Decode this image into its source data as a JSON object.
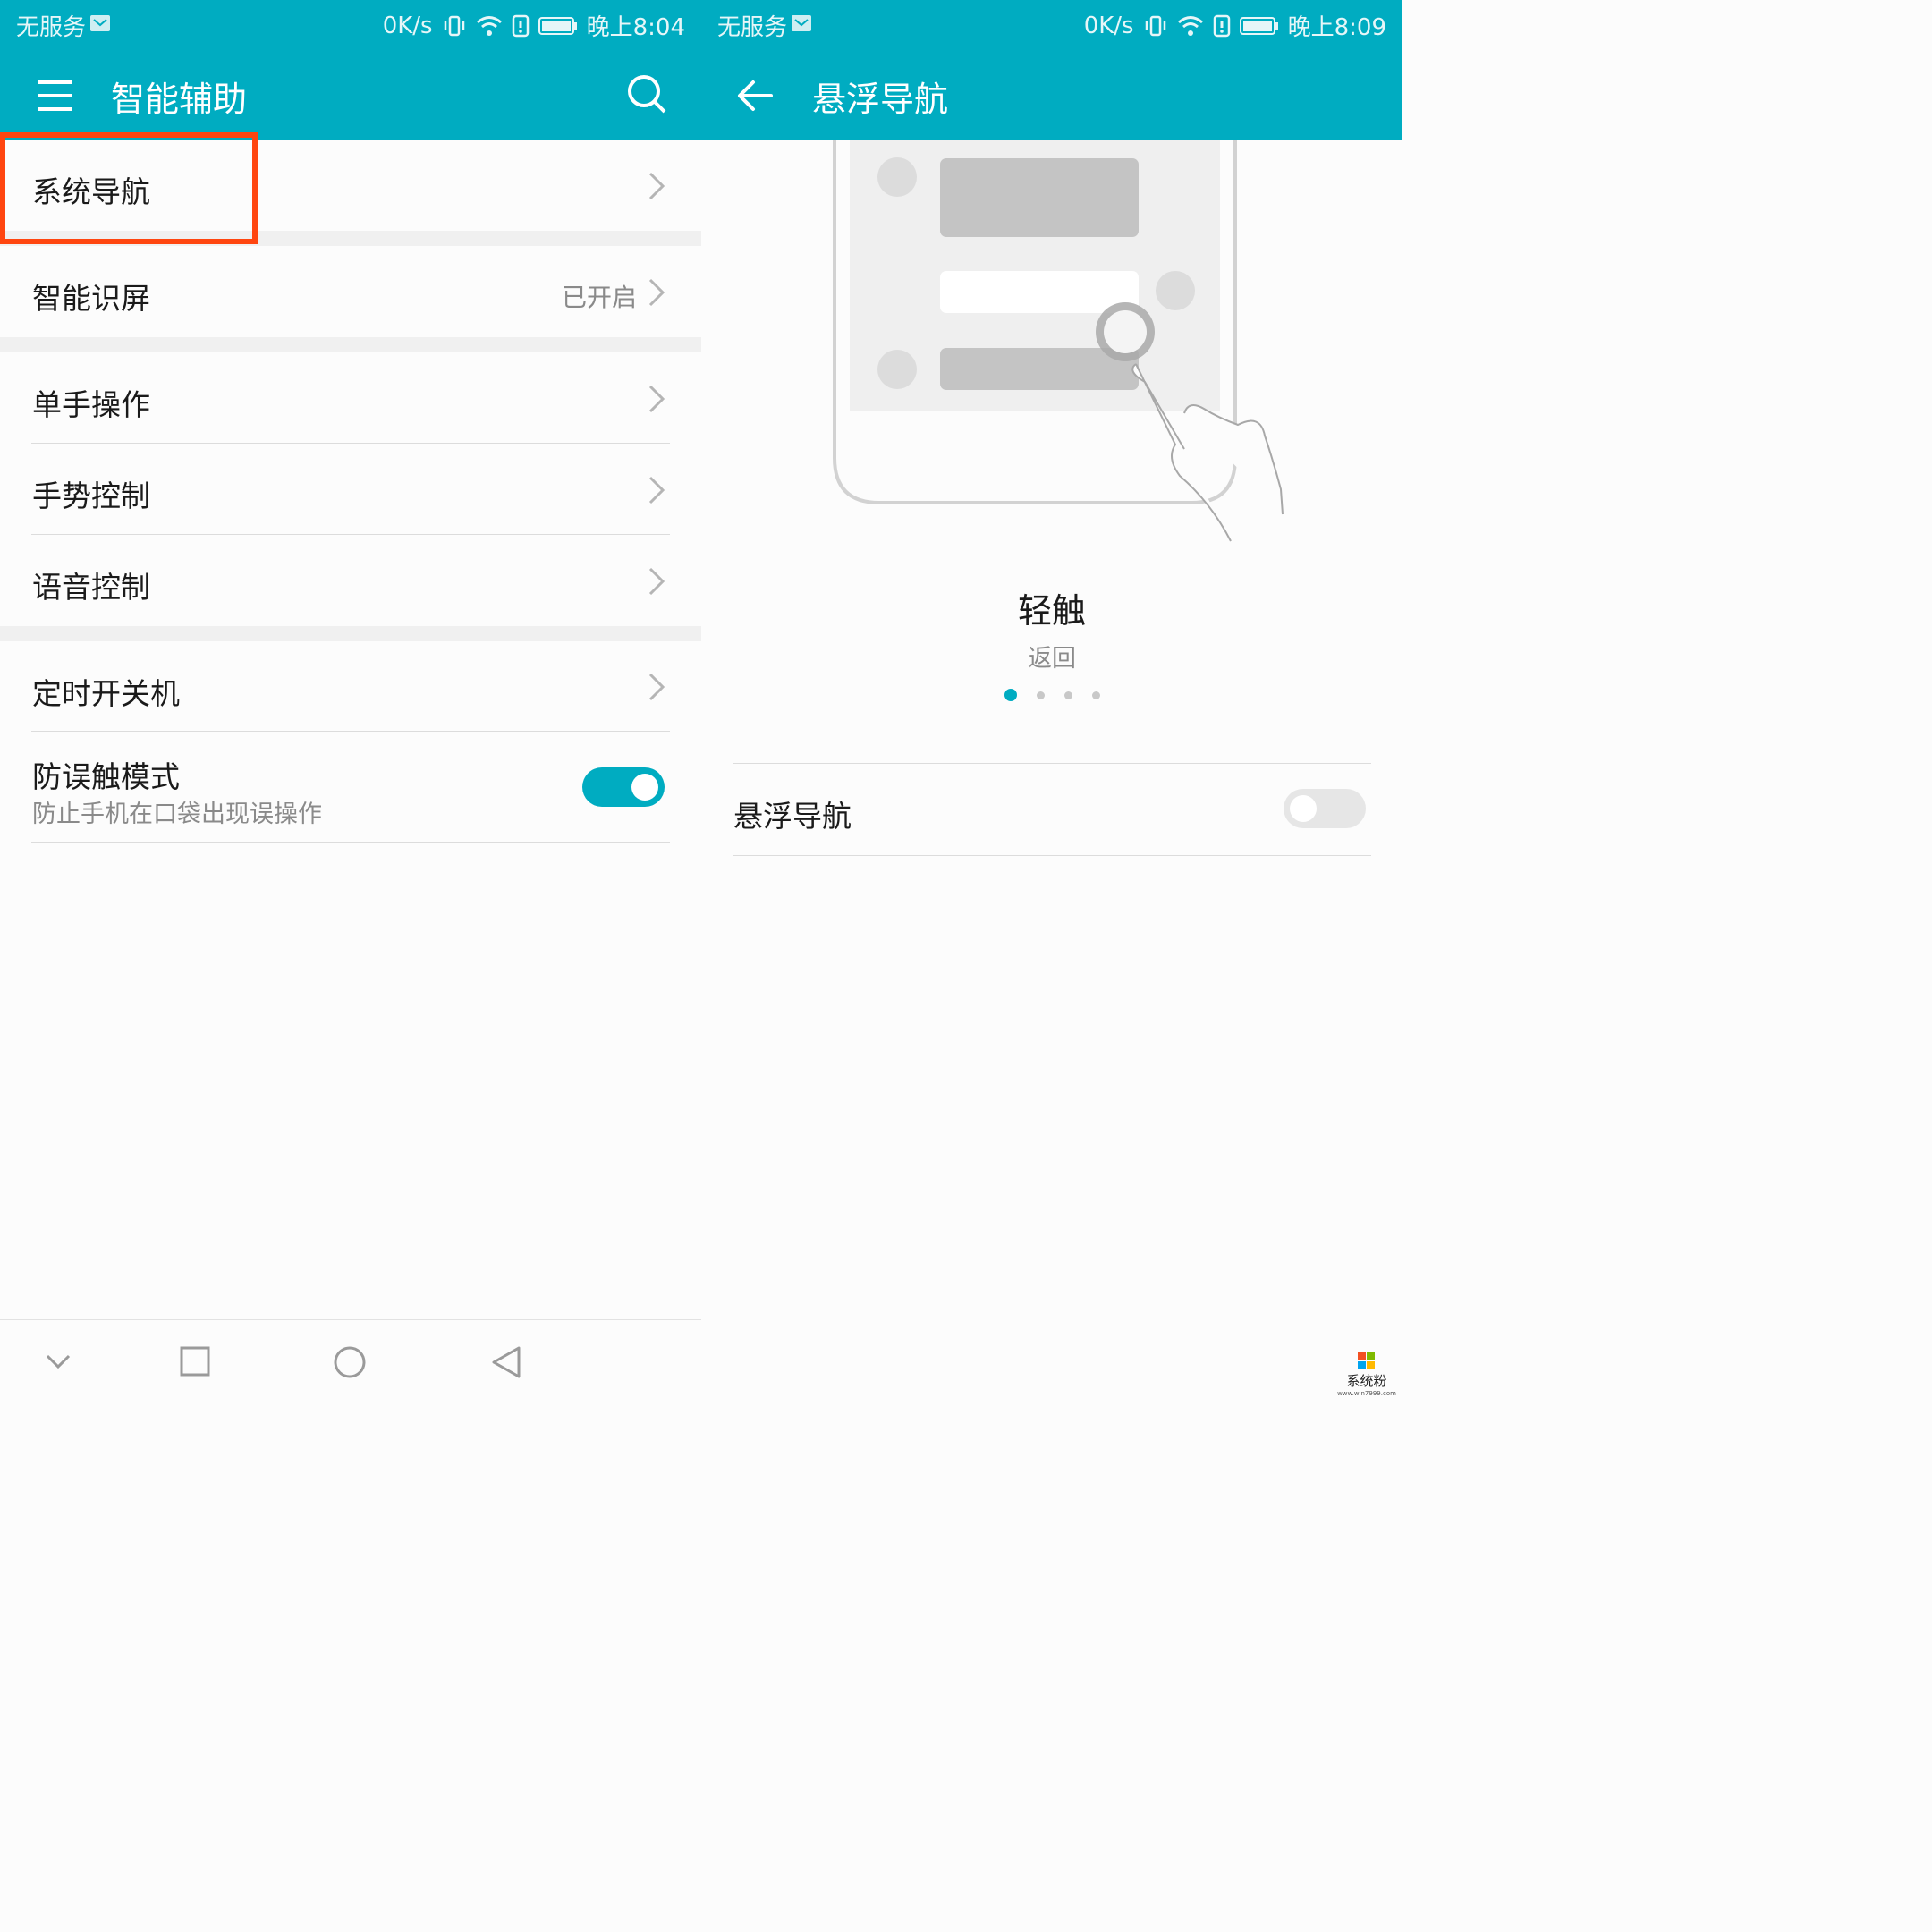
{
  "left_screen": {
    "status": {
      "carrier": "无服务",
      "speed": "0K/s",
      "time": "晚上8:04"
    },
    "appbar": {
      "title": "智能辅助",
      "menu_icon": "menu-icon",
      "search_icon": "search-icon"
    },
    "items": [
      {
        "label": "系统导航",
        "value": ""
      },
      {
        "label": "智能识屏",
        "value": "已开启"
      },
      {
        "label": "单手操作",
        "value": ""
      },
      {
        "label": "手势控制",
        "value": ""
      },
      {
        "label": "语音控制",
        "value": ""
      },
      {
        "label": "定时开关机",
        "value": ""
      }
    ],
    "misoperation": {
      "label": "防误触模式",
      "sub": "防止手机在口袋出现误操作",
      "enabled": true
    },
    "highlight_color": "#ff4610",
    "navbar_icons": [
      "chevron-down-icon",
      "recent-square-icon",
      "home-circle-icon",
      "back-triangle-icon"
    ]
  },
  "right_screen": {
    "status": {
      "carrier": "无服务",
      "speed": "0K/s",
      "time": "晚上8:09"
    },
    "appbar": {
      "title": "悬浮导航",
      "back_icon": "back-arrow-icon"
    },
    "illustration": {
      "icon": "hand-tap-illustration"
    },
    "caption": {
      "title": "轻触",
      "subtitle": "返回"
    },
    "page_indicator": {
      "count": 4,
      "active": 1
    },
    "setting": {
      "label": "悬浮导航",
      "enabled": false
    },
    "watermark": {
      "text": "系统粉",
      "url": "www.win7999.com"
    }
  },
  "colors": {
    "accent": "#00acc1",
    "toggle_off": "#e6e6e6"
  }
}
